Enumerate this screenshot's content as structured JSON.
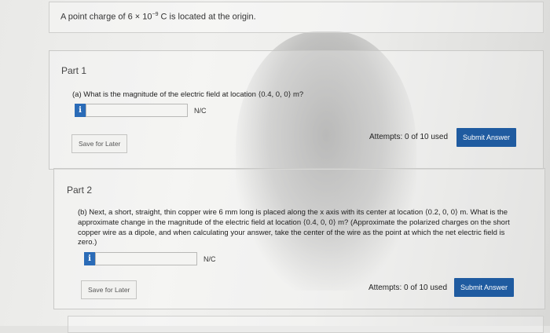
{
  "intro": {
    "text_prefix": "A point charge of 6 × 10",
    "exponent": "−9",
    "text_suffix": " C is located at the origin."
  },
  "part1": {
    "title": "Part 1",
    "question": "(a) What is the magnitude of the electric field at location ⟨0.4, 0, 0⟩ m?",
    "info_label": "i",
    "answer_value": "",
    "unit": "N/C",
    "save_label": "Save for Later",
    "attempts": "Attempts: 0 of 10 used",
    "submit_label": "Submit Answer"
  },
  "part2": {
    "title": "Part 2",
    "question": "(b) Next, a short, straight, thin copper wire 6 mm long is placed along the x axis with its center at location ⟨0.2, 0, 0⟩ m. What is the approximate change in the magnitude of the electric field at location ⟨0.4, 0, 0⟩ m? (Approximate the polarized charges on the short copper wire as a dipole, and when calculating your answer, take the center of the wire as the point at which the net electric field is zero.)",
    "info_label": "i",
    "answer_value": "",
    "unit": "N/C",
    "save_label": "Save for Later",
    "attempts": "Attempts: 0 of 10 used",
    "submit_label": "Submit Answer"
  },
  "colors": {
    "info_button": "#2a6bb7",
    "submit_button": "#1f5ba0"
  }
}
